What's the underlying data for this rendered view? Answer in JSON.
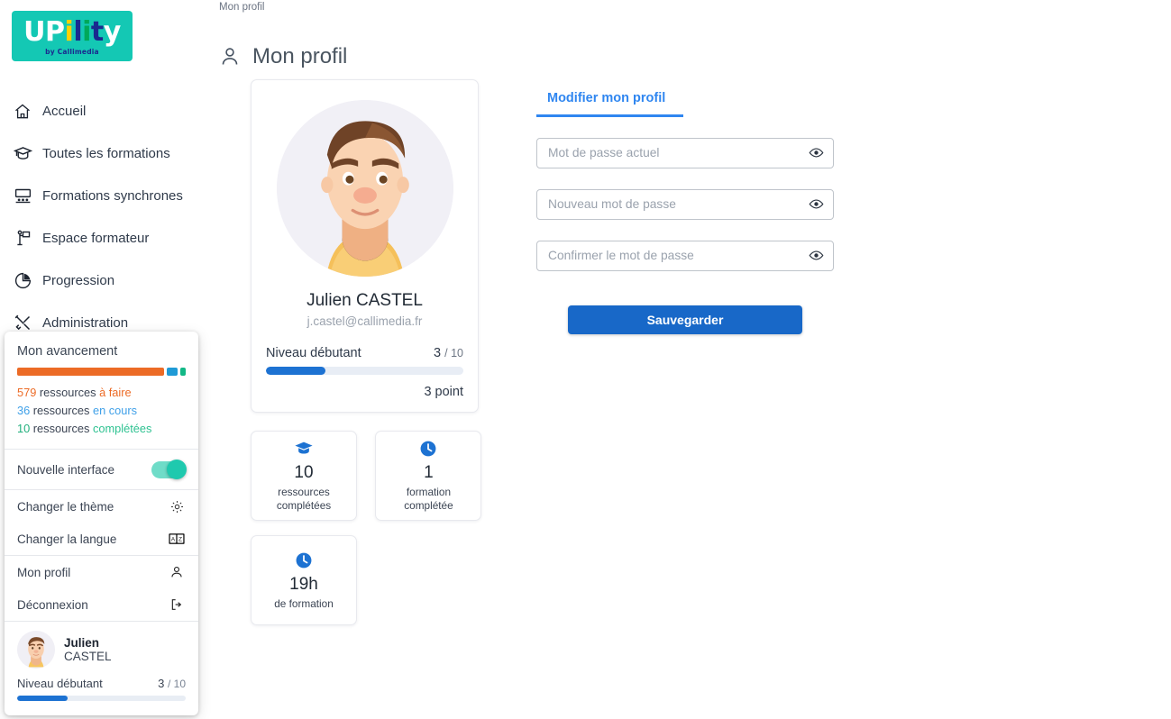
{
  "brand": {
    "logo_letters": [
      {
        "ch": "U",
        "color": "#ffffff"
      },
      {
        "ch": "P",
        "color": "#ffffff"
      },
      {
        "ch": "i",
        "color": "#ffd200"
      },
      {
        "ch": "l",
        "color": "#1a2a8f"
      },
      {
        "ch": "i",
        "color": "#00a859"
      },
      {
        "ch": "t",
        "color": "#1a2a8f"
      },
      {
        "ch": "y",
        "color": "#ffffff"
      }
    ],
    "logo_name": "UPility",
    "logo_tagline": "by Callimedia",
    "logo_bg": "#14c8b4"
  },
  "sidebar": {
    "items": [
      {
        "label": "Accueil",
        "icon": "home-icon"
      },
      {
        "label": "Toutes les formations",
        "icon": "graduation-cap-icon"
      },
      {
        "label": "Formations synchrones",
        "icon": "classroom-icon"
      },
      {
        "label": "Espace formateur",
        "icon": "podium-flag-icon"
      },
      {
        "label": "Progression",
        "icon": "pie-chart-icon"
      },
      {
        "label": "Administration",
        "icon": "tools-icon"
      }
    ]
  },
  "menu": {
    "title": "Mon avancement",
    "segments": [
      {
        "name": "a-faire",
        "color": "#ec6b26",
        "percent": 88
      },
      {
        "name": "en-cours",
        "color": "#1f9ad6",
        "percent": 7
      },
      {
        "name": "completees",
        "color": "#12b886",
        "percent": 3
      }
    ],
    "stats": [
      {
        "count": "579",
        "noun": "ressources",
        "state": "à faire",
        "color": "#ec6b26"
      },
      {
        "count": "36",
        "noun": "ressources",
        "state": "en cours",
        "color": "#3fa0e8"
      },
      {
        "count": "10",
        "noun": "ressources",
        "state": "complétées",
        "color": "#2ec291"
      }
    ],
    "new_interface_label": "Nouvelle interface",
    "new_interface_on": true,
    "rows": [
      {
        "label": "Changer le thème",
        "icon": "sun-icon"
      },
      {
        "label": "Changer la langue",
        "icon": "translate-icon"
      },
      {
        "label": "Mon profil",
        "icon": "person-icon"
      },
      {
        "label": "Déconnexion",
        "icon": "logout-icon"
      }
    ],
    "user": {
      "first_name": "Julien",
      "last_name": "CASTEL",
      "level_label": "Niveau débutant",
      "level_value": "3",
      "level_separator": "/",
      "level_max": "10",
      "level_percent": 30
    }
  },
  "header": {
    "breadcrumb": "Mon profil",
    "title": "Mon profil",
    "title_icon": "person-icon"
  },
  "profile": {
    "avatar": "user-avatar-illustration",
    "name": "Julien CASTEL",
    "email": "j.castel@callimedia.fr",
    "level_label": "Niveau débutant",
    "level_value": "3",
    "level_separator": "/",
    "level_max": "10",
    "level_percent": 30,
    "points": "3 point"
  },
  "stats_cards": [
    {
      "icon": "graduation-cap-icon",
      "value": "10",
      "line1": "ressources",
      "line2": "complétées"
    },
    {
      "icon": "clock-icon",
      "value": "1",
      "line1": "formation",
      "line2": "complétée"
    },
    {
      "icon": "clock-icon",
      "value": "19h",
      "line1": "de formation",
      "line2": ""
    }
  ],
  "form": {
    "tab_label": "Modifier mon profil",
    "fields": [
      {
        "name": "current-password",
        "placeholder": "Mot de passe actuel",
        "value": ""
      },
      {
        "name": "new-password",
        "placeholder": "Nouveau mot de passe",
        "value": ""
      },
      {
        "name": "confirm-password",
        "placeholder": "Confirmer le mot de passe",
        "value": ""
      }
    ],
    "save_label": "Sauvegarder",
    "accent": "#1868c8"
  }
}
